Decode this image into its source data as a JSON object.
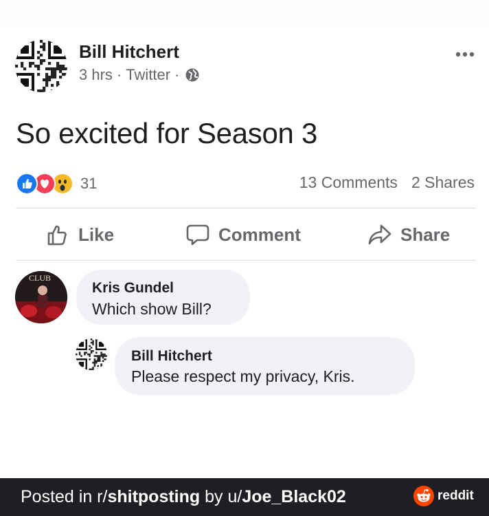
{
  "post": {
    "author": "Bill Hitchert",
    "time": "3 hrs",
    "separator": "·",
    "source": "Twitter",
    "text": "So excited for Season 3",
    "reaction_count": "31",
    "comments_count": "13 Comments",
    "shares_count": "2 Shares"
  },
  "actions": {
    "like": "Like",
    "comment": "Comment",
    "share": "Share"
  },
  "comments": [
    {
      "author": "Kris Gundel",
      "text": "Which show Bill?",
      "avatar_text": "CLUB"
    },
    {
      "author": "Bill Hitchert",
      "text": "Please respect my privacy, Kris."
    }
  ],
  "footer": {
    "prefix": "Posted in r/",
    "subreddit": "shitposting",
    "by": " by u/",
    "user": "Joe_Black02",
    "brand": "reddit"
  },
  "colors": {
    "like_blue": "#1877f2",
    "love_red": "#f33e58",
    "wow_yellow": "#f7b928",
    "muted_text": "#65676b",
    "bubble_bg": "#f0f2f5",
    "footer_bg": "#1e1f22",
    "reddit_orange": "#ff4500"
  },
  "icons": [
    "qr-code-avatar-icon",
    "globe-icon",
    "more-options-icon",
    "like-reaction-icon",
    "love-reaction-icon",
    "wow-reaction-icon",
    "thumbs-up-icon",
    "comment-bubble-icon",
    "share-arrow-icon",
    "reddit-logo-icon"
  ]
}
